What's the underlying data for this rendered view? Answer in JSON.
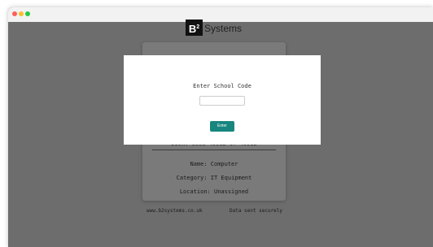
{
  "brand": {
    "mark": "B",
    "mark_sup": "2",
    "name": "Systems"
  },
  "device_card": {
    "disk": "Disk: Used 459GB of 499GB",
    "name": "Name: Computer",
    "category": "Category: IT Equipment",
    "location": "Location: Unassigned"
  },
  "footer": {
    "website": "www.b2systems.co.uk",
    "security": "Data sent securely"
  },
  "modal": {
    "title": "Enter School Code",
    "input_value": "",
    "input_placeholder": "",
    "button_label": "Enter"
  },
  "colors": {
    "accent": "#18857f",
    "overlay": "#6d6d6d"
  }
}
